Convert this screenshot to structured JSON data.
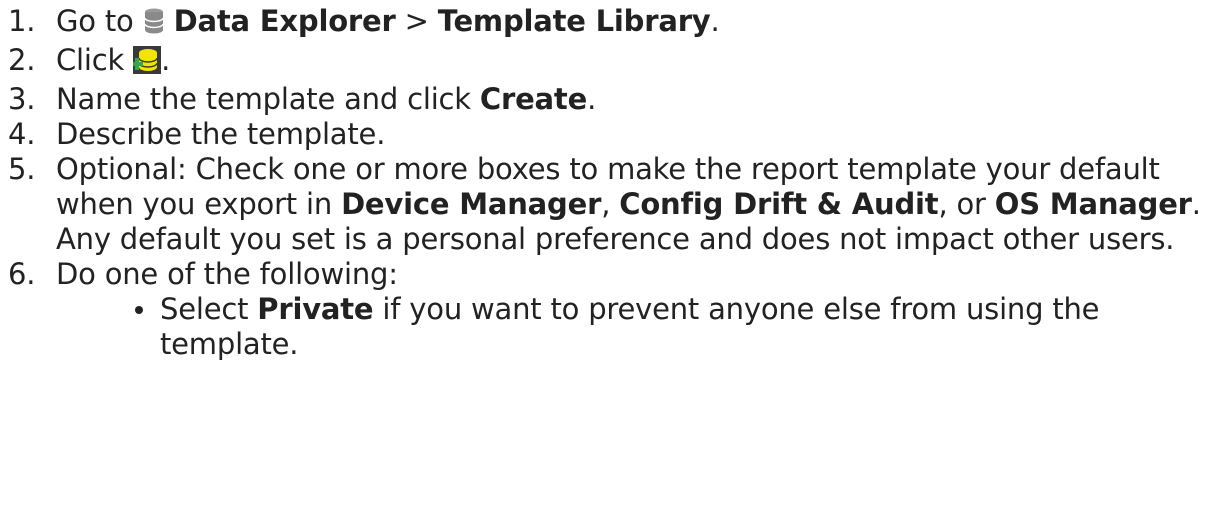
{
  "steps": [
    {
      "num": "1.",
      "t1": "Go to ",
      "icon": "database-icon",
      "b1": "Data Explorer",
      "t2": " > ",
      "b2": "Template Library",
      "t3": "."
    },
    {
      "num": "2.",
      "t1": "Click ",
      "icon": "add-report-template-icon",
      "t2": "."
    },
    {
      "num": "3.",
      "t1": "Name the template and click ",
      "b1": "Create",
      "t2": "."
    },
    {
      "num": "4.",
      "t1": "Describe the template."
    },
    {
      "num": "5.",
      "t1": "Optional: Check one or more boxes to make the report template your default when you export in ",
      "b1": "Device Manager",
      "t2": ", ",
      "b2": "Config Drift & Audit",
      "t3": ", or ",
      "b3": "OS Manager",
      "t4": ". Any default you set is a personal preference and does not impact other users."
    },
    {
      "num": "6.",
      "t1": "Do one of the following:",
      "sub": [
        {
          "t1": "Select ",
          "b1": "Private",
          "t2": " if you want to prevent anyone else from using the template."
        }
      ]
    }
  ],
  "colors": {
    "text": "#222222",
    "icon_yellow": "#f2e600",
    "icon_green": "#2fa84f",
    "icon_gray": "#8a8a8a"
  }
}
